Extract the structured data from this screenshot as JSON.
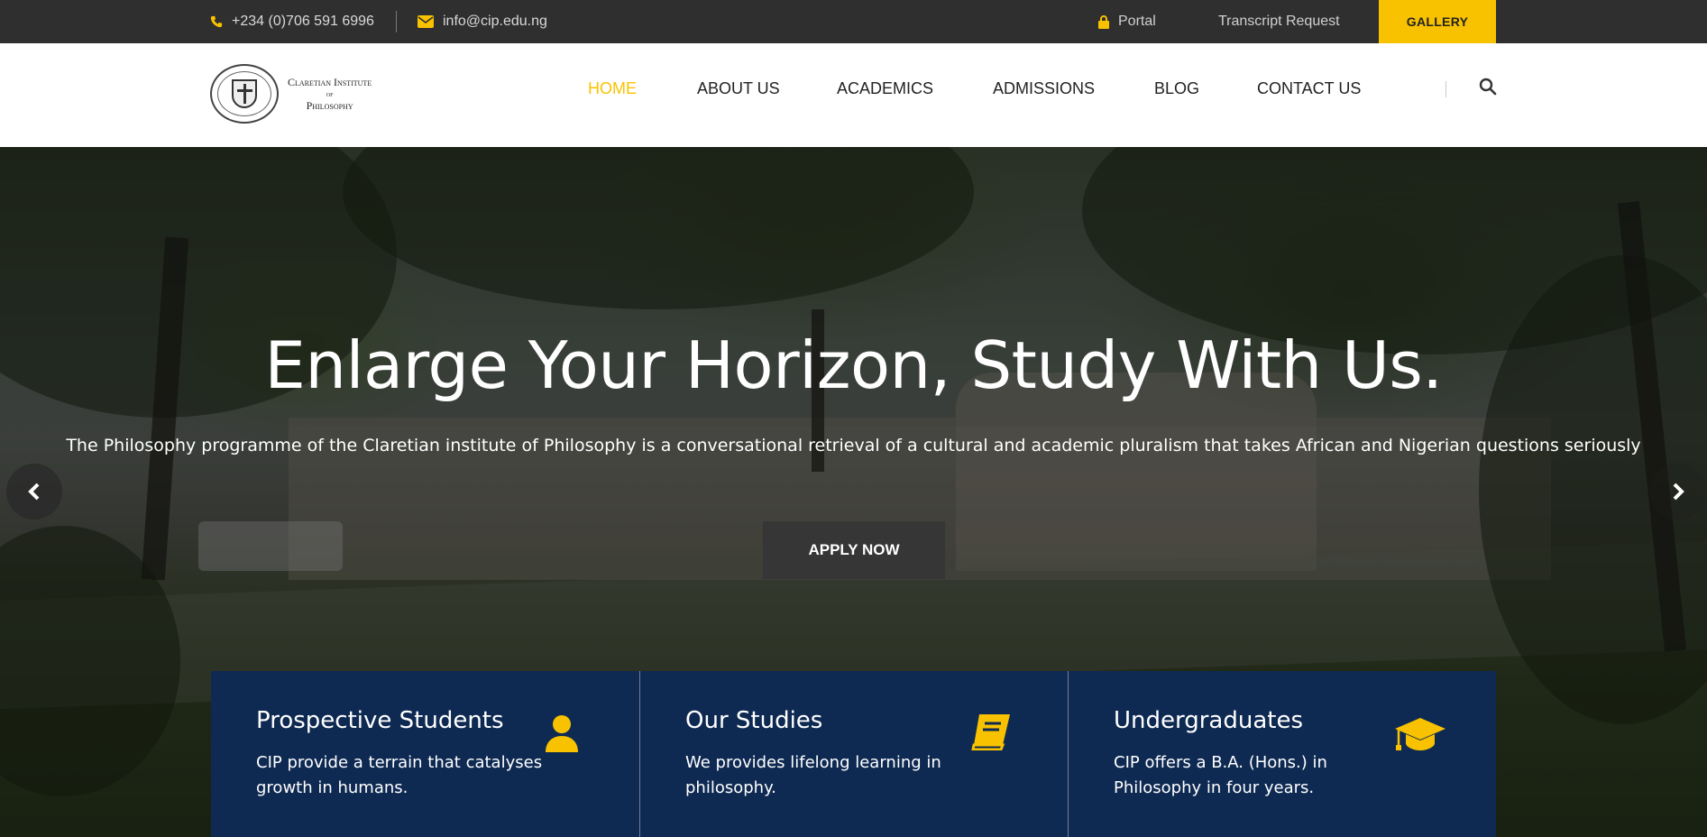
{
  "topbar": {
    "phone": "+234 (0)706 591 6996",
    "email": "info@cip.edu.ng",
    "portal": "Portal",
    "transcript": "Transcript Request",
    "gallery": "GALLERY"
  },
  "logo": {
    "line1": "Claretian Institute",
    "line2": "of",
    "line3": "Philosophy"
  },
  "nav": {
    "items": [
      {
        "label": "HOME",
        "active": true
      },
      {
        "label": "ABOUT US"
      },
      {
        "label": "ACADEMICS"
      },
      {
        "label": "ADMISSIONS"
      },
      {
        "label": "BLOG"
      },
      {
        "label": "CONTACT US"
      }
    ]
  },
  "hero": {
    "title": "Enlarge Your Horizon, Study With Us.",
    "subtitle": "The Philosophy programme of the Claretian institute of Philosophy is a conversational retrieval of a cultural and academic pluralism that takes African and Nigerian questions seriously",
    "cta": "APPLY NOW"
  },
  "cards": [
    {
      "title": "Prospective Students",
      "text": "CIP provide a terrain that catalyses growth in humans.",
      "icon": "user-icon"
    },
    {
      "title": "Our Studies",
      "text": "We provides lifelong learning in philosophy.",
      "icon": "book-icon"
    },
    {
      "title": "Undergraduates",
      "text": "CIP offers a B.A. (Hons.) in Philosophy in four years.",
      "icon": "graduation-cap-icon"
    }
  ],
  "colors": {
    "accent": "#f8c200",
    "topbar": "#2f2f2f",
    "card_bg": "#0f2a52",
    "button": "#363636"
  }
}
